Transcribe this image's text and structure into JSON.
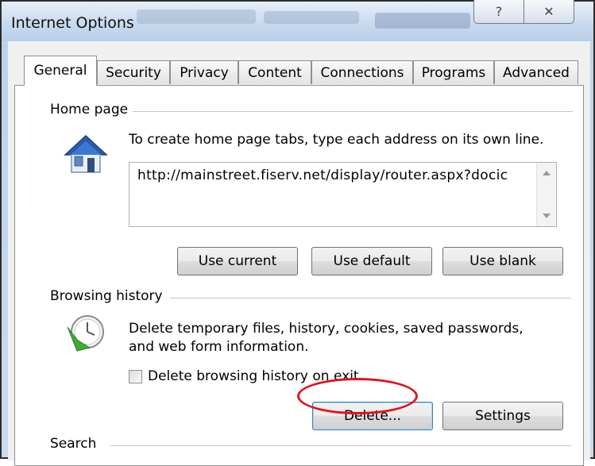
{
  "window": {
    "title": "Internet Options",
    "help_glyph": "?",
    "close_glyph": "✕"
  },
  "tabs": [
    {
      "label": "General",
      "active": true
    },
    {
      "label": "Security",
      "active": false
    },
    {
      "label": "Privacy",
      "active": false
    },
    {
      "label": "Content",
      "active": false
    },
    {
      "label": "Connections",
      "active": false
    },
    {
      "label": "Programs",
      "active": false
    },
    {
      "label": "Advanced",
      "active": false
    }
  ],
  "home_page": {
    "group_label": "Home page",
    "description": "To create home page tabs, type each address on its own line.",
    "url_value": "http://mainstreet.fiserv.net/display/router.aspx?docic",
    "buttons": {
      "use_current": "Use current",
      "use_default": "Use default",
      "use_blank": "Use blank"
    }
  },
  "browsing_history": {
    "group_label": "Browsing history",
    "description_line1": "Delete temporary files, history, cookies, saved passwords,",
    "description_line2": "and web form information.",
    "checkbox_label": "Delete browsing history on exit",
    "checkbox_checked": false,
    "buttons": {
      "delete": "Delete...",
      "settings": "Settings"
    },
    "highlight_color": "#e0141e"
  },
  "search": {
    "group_label": "Search"
  },
  "icons": {
    "home": "house-icon",
    "history": "history-clock-icon"
  }
}
